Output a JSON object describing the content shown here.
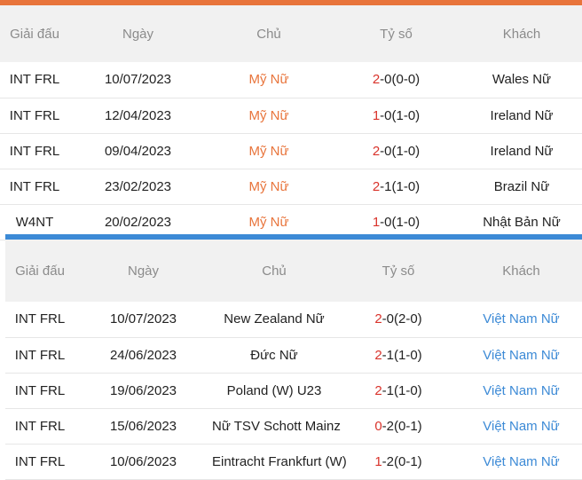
{
  "colors": {
    "top_accent": "#e8743b",
    "divider_accent": "#3c8ad6",
    "header_bg": "#f1f1f1",
    "home_highlight": "#e8743b",
    "away_highlight": "#3c8ad6",
    "score_first": "#d9332b"
  },
  "columns": {
    "league": "Giải đấu",
    "date": "Ngày",
    "home": "Chủ",
    "score": "Tỷ số",
    "away": "Khách"
  },
  "table1": {
    "rows": [
      {
        "league": "INT FRL",
        "date": "10/07/2023",
        "home": "Mỹ Nữ",
        "score_first": "2",
        "score_rest": "-0(0-0)",
        "away": "Wales Nữ"
      },
      {
        "league": "INT FRL",
        "date": "12/04/2023",
        "home": "Mỹ Nữ",
        "score_first": "1",
        "score_rest": "-0(1-0)",
        "away": "Ireland Nữ"
      },
      {
        "league": "INT FRL",
        "date": "09/04/2023",
        "home": "Mỹ Nữ",
        "score_first": "2",
        "score_rest": "-0(1-0)",
        "away": "Ireland Nữ"
      },
      {
        "league": "INT FRL",
        "date": "23/02/2023",
        "home": "Mỹ Nữ",
        "score_first": "2",
        "score_rest": "-1(1-0)",
        "away": "Brazil Nữ"
      },
      {
        "league": "W4NT",
        "date": "20/02/2023",
        "home": "Mỹ Nữ",
        "score_first": "1",
        "score_rest": "-0(1-0)",
        "away": "Nhật Bản Nữ"
      }
    ]
  },
  "table2": {
    "rows": [
      {
        "league": "INT FRL",
        "date": "10/07/2023",
        "home": "New Zealand Nữ",
        "score_first": "2",
        "score_rest": "-0(2-0)",
        "away": "Việt Nam Nữ"
      },
      {
        "league": "INT FRL",
        "date": "24/06/2023",
        "home": "Đức Nữ",
        "score_first": "2",
        "score_rest": "-1(1-0)",
        "away": "Việt Nam Nữ"
      },
      {
        "league": "INT FRL",
        "date": "19/06/2023",
        "home": "Poland (W) U23",
        "score_first": "2",
        "score_rest": "-1(1-0)",
        "away": "Việt Nam Nữ"
      },
      {
        "league": "INT FRL",
        "date": "15/06/2023",
        "home": "Nữ TSV Schott Mainz",
        "score_first": "0",
        "score_rest": "-2(0-1)",
        "away": "Việt Nam Nữ"
      },
      {
        "league": "INT FRL",
        "date": "10/06/2023",
        "home": "Eintracht Frankfurt (W)",
        "score_first": "1",
        "score_rest": "-2(0-1)",
        "away": "Việt Nam Nữ"
      }
    ]
  }
}
